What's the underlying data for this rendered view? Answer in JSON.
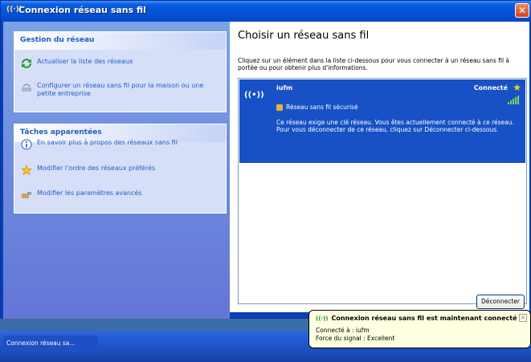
{
  "window": {
    "title": "Connexion réseau sans fil",
    "title_icon": "wireless-icon",
    "close_label": "✕"
  },
  "leftpane": {
    "network_tasks": {
      "header": "Gestion du réseau",
      "items": [
        {
          "label": "Actualiser la liste des réseaux",
          "icon": "refresh-icon"
        },
        {
          "label": "Configurer un réseau sans fil pour la maison ou une petite entreprise",
          "icon": "setup-wizard-icon"
        }
      ]
    },
    "related_tasks": {
      "header": "Tâches apparentées",
      "items": [
        {
          "label": "En savoir plus à propos des réseaux sans fil",
          "icon": "info-icon"
        },
        {
          "label": "Modifier l'ordre des réseaux préférés",
          "icon": "star-icon"
        },
        {
          "label": "Modifier les paramètres avancés",
          "icon": "settings-icon"
        }
      ]
    }
  },
  "content": {
    "heading": "Choisir un réseau sans fil",
    "intro": "Cliquez sur un élément dans la liste ci-dessous pour vous connecter à un réseau sans fil à portée ou pour obtenir plus d'informations.",
    "networks": [
      {
        "name": "iufm",
        "status": "Connecté",
        "security": "Réseau sans fil sécurisé",
        "description": "Ce réseau exige une clé réseau. Vous êtes actuellement connecté à ce réseau. Pour vous déconnecter de ce réseau, cliquez sur Déconnecter ci-dessous.",
        "signal_bars": 5
      }
    ],
    "disconnect_label": "Déconnecter"
  },
  "balloon": {
    "title": "Connexion réseau sans fil est maintenant connecté",
    "line1": "Connecté à : iufm",
    "line2": "Force du signal : Excellent"
  },
  "taskbar": {
    "button_label": "Connexion réseau sa..."
  },
  "colors": {
    "titlebar": "#0552d6",
    "selected_item": "#1751c5",
    "task_link": "#215dc6",
    "balloon_bg": "#ffffe1"
  }
}
